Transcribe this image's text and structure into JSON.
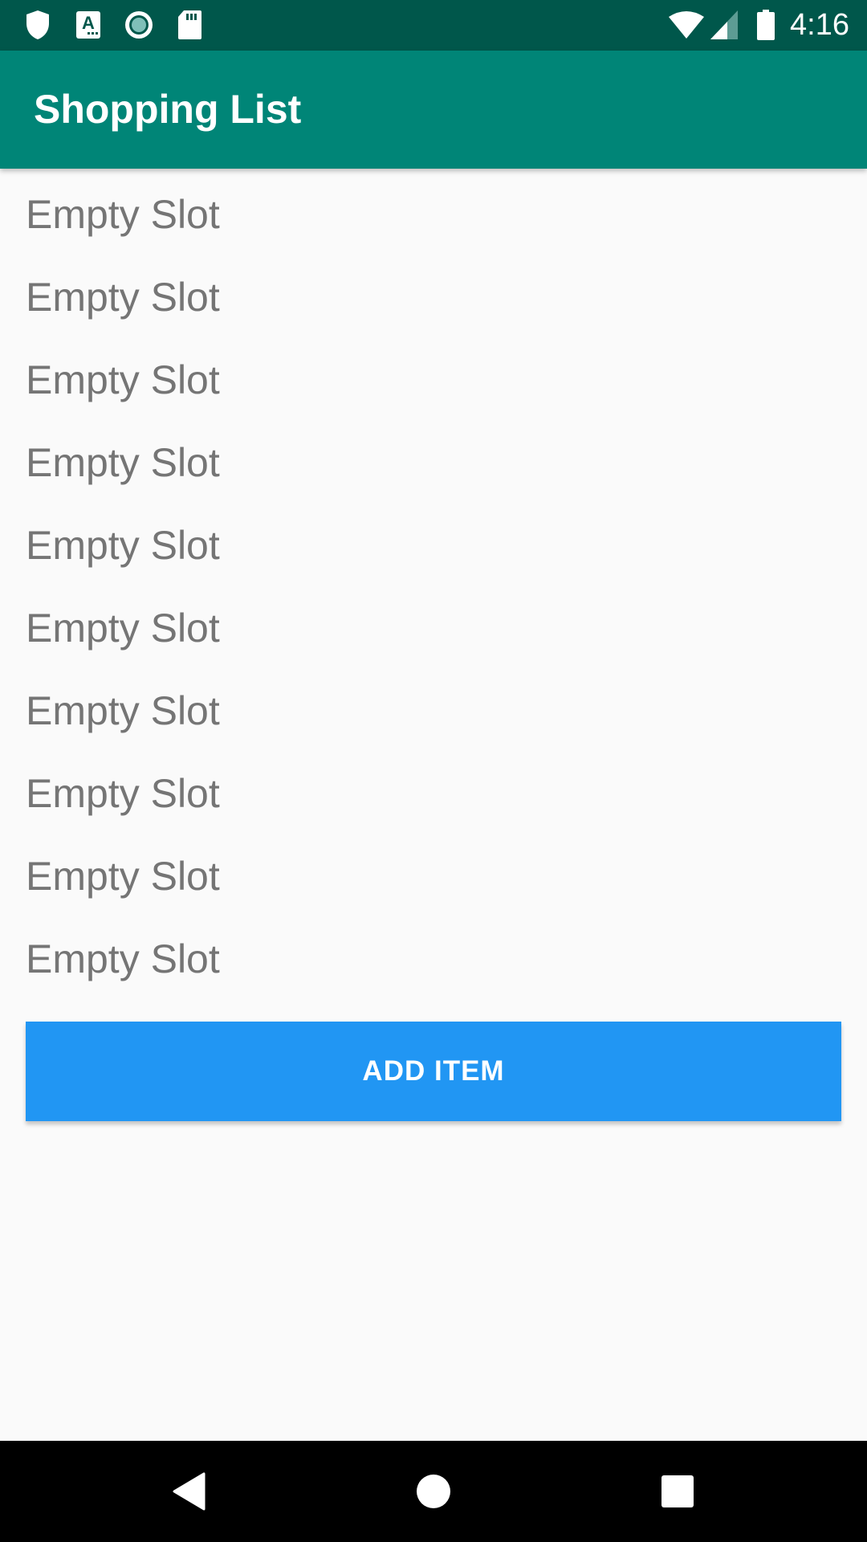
{
  "status_bar": {
    "time": "4:16",
    "left_icons": [
      "shield-icon",
      "font-a-icon",
      "circle-record-icon",
      "sd-card-icon"
    ],
    "right_icons": [
      "wifi-icon",
      "cell-signal-icon",
      "battery-icon"
    ],
    "background_color": "#00574b"
  },
  "app_bar": {
    "title": "Shopping List",
    "background_color": "#008577"
  },
  "list": {
    "items": [
      {
        "label": "Empty Slot"
      },
      {
        "label": "Empty Slot"
      },
      {
        "label": "Empty Slot"
      },
      {
        "label": "Empty Slot"
      },
      {
        "label": "Empty Slot"
      },
      {
        "label": "Empty Slot"
      },
      {
        "label": "Empty Slot"
      },
      {
        "label": "Empty Slot"
      },
      {
        "label": "Empty Slot"
      },
      {
        "label": "Empty Slot"
      }
    ],
    "text_color": "#757575"
  },
  "add_button": {
    "label": "ADD ITEM",
    "color": "#2196f3"
  },
  "nav_bar": {
    "buttons": [
      "back-icon",
      "home-icon",
      "recents-icon"
    ]
  }
}
